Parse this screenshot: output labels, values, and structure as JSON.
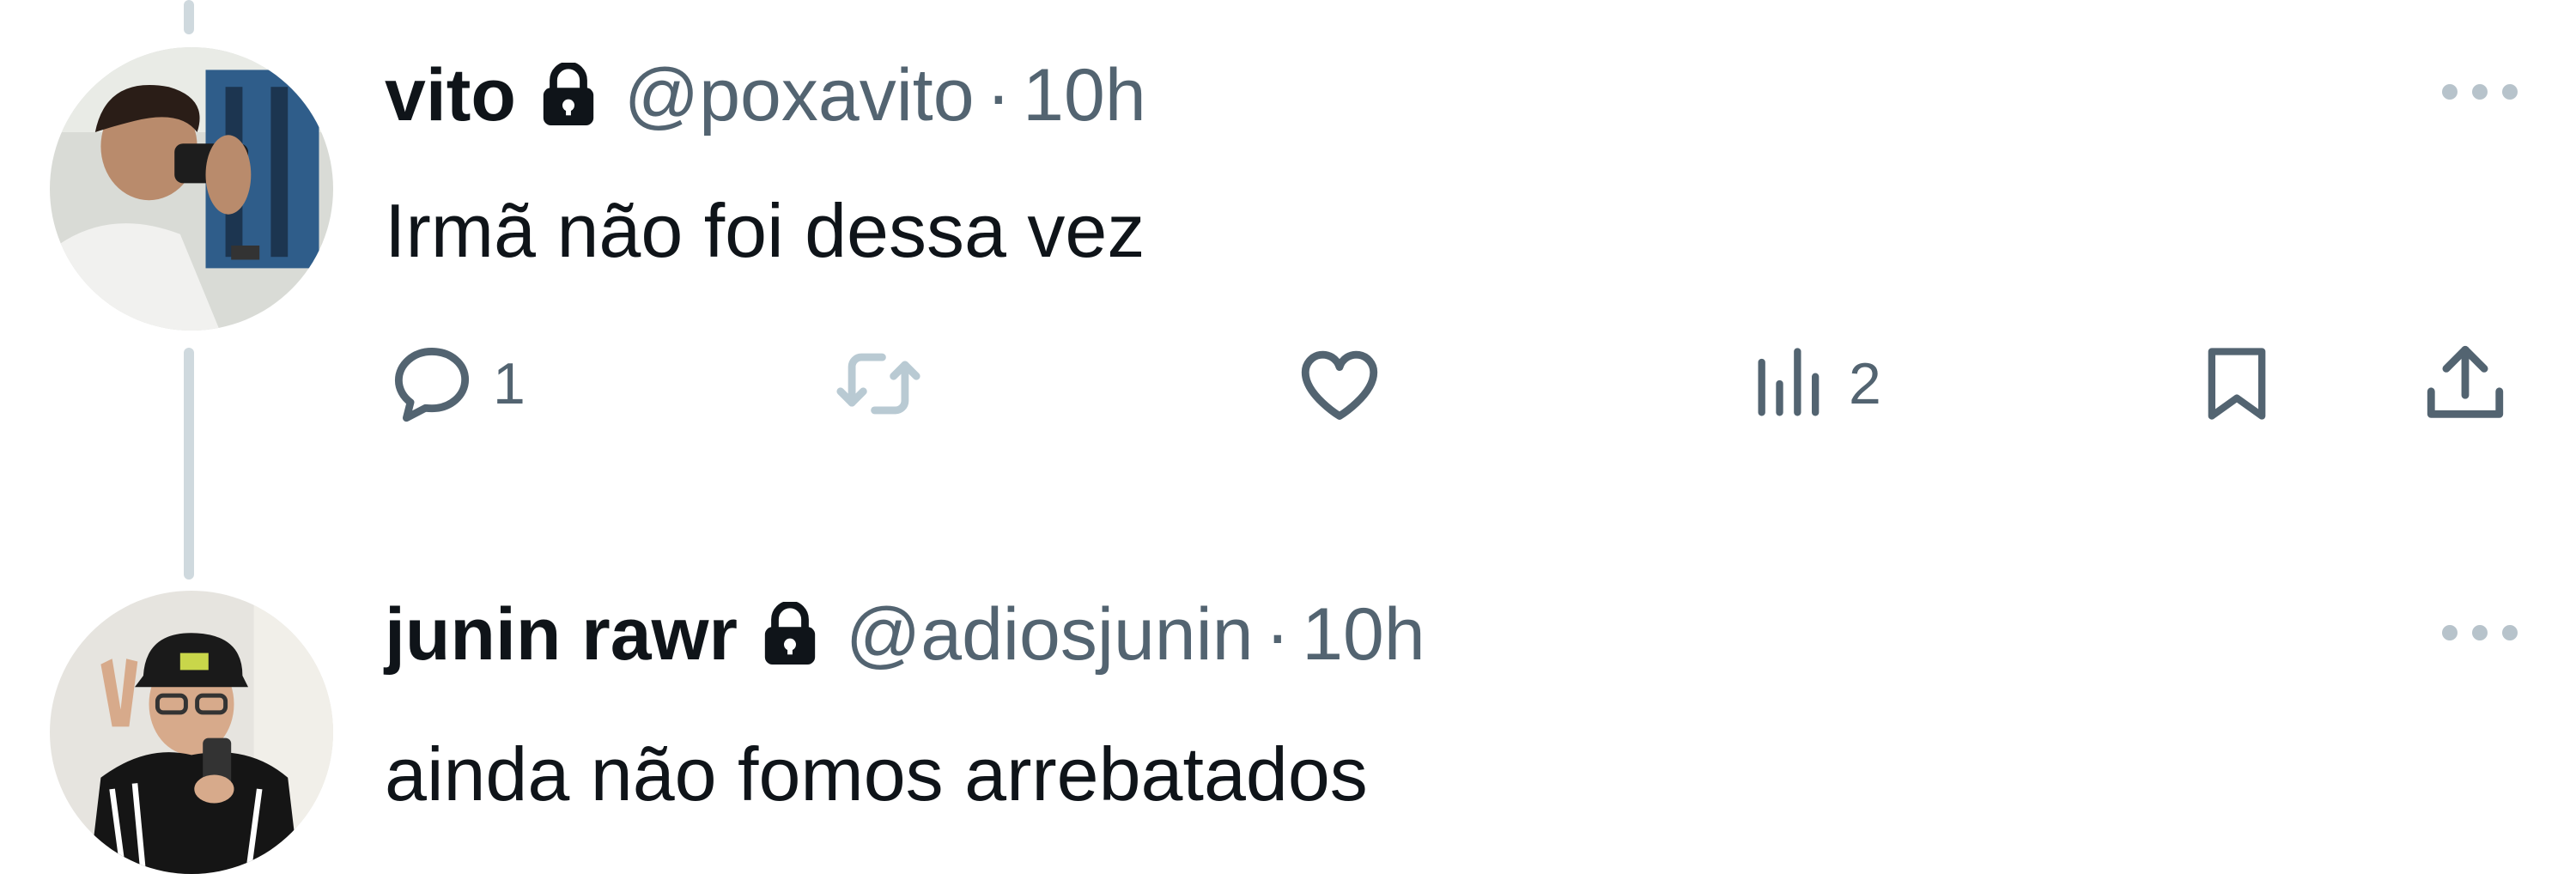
{
  "tweets": [
    {
      "display_name": "vito",
      "handle": "@poxavito",
      "separator": "·",
      "time": "10h",
      "text": "Irmã não foi dessa vez",
      "avatar_icon": "avatar-photo",
      "protected_icon": "lock-icon",
      "menu_icon": "more-icon",
      "actions": {
        "reply_count": "1",
        "retweet_count": "",
        "like_count": "",
        "views_count": "2"
      }
    },
    {
      "display_name": "junin rawr",
      "handle": "@adiosjunin",
      "separator": "·",
      "time": "10h",
      "text": "ainda não fomos arrebatados",
      "avatar_icon": "avatar-photo",
      "protected_icon": "lock-icon",
      "menu_icon": "more-icon"
    }
  ],
  "action_icons": [
    "reply-icon",
    "retweet-icon",
    "like-icon",
    "views-icon",
    "bookmark-icon",
    "share-icon"
  ],
  "colors": {
    "text_primary": "#0f1419",
    "text_secondary": "#536471",
    "thread_line": "#cfd9de",
    "retweet_disabled": "#b9cad3"
  }
}
